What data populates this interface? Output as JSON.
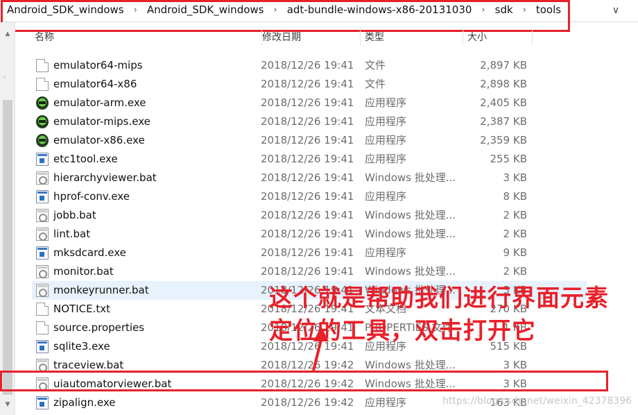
{
  "breadcrumbs": [
    "Android_SDK_windows",
    "Android_SDK_windows",
    "adt-bundle-windows-x86-20131030",
    "sdk",
    "tools"
  ],
  "addr_dropdown_glyph": "∨",
  "columns": {
    "name": "名称",
    "date": "修改日期",
    "type": "类型",
    "size": "大小"
  },
  "rows": [
    {
      "name": "emulator64-mips",
      "date": "2018/12/26 19:41",
      "type": "文件",
      "size": "2,897 KB",
      "icon": "file"
    },
    {
      "name": "emulator64-x86",
      "date": "2018/12/26 19:41",
      "type": "文件",
      "size": "2,898 KB",
      "icon": "file"
    },
    {
      "name": "emulator-arm.exe",
      "date": "2018/12/26 19:41",
      "type": "应用程序",
      "size": "2,405 KB",
      "icon": "emu"
    },
    {
      "name": "emulator-mips.exe",
      "date": "2018/12/26 19:41",
      "type": "应用程序",
      "size": "2,387 KB",
      "icon": "emu"
    },
    {
      "name": "emulator-x86.exe",
      "date": "2018/12/26 19:41",
      "type": "应用程序",
      "size": "2,359 KB",
      "icon": "emu"
    },
    {
      "name": "etc1tool.exe",
      "date": "2018/12/26 19:41",
      "type": "应用程序",
      "size": "255 KB",
      "icon": "exe"
    },
    {
      "name": "hierarchyviewer.bat",
      "date": "2018/12/26 19:41",
      "type": "Windows 批处理...",
      "size": "3 KB",
      "icon": "bat"
    },
    {
      "name": "hprof-conv.exe",
      "date": "2018/12/26 19:41",
      "type": "应用程序",
      "size": "8 KB",
      "icon": "exe"
    },
    {
      "name": "jobb.bat",
      "date": "2018/12/26 19:41",
      "type": "Windows 批处理...",
      "size": "2 KB",
      "icon": "bat"
    },
    {
      "name": "lint.bat",
      "date": "2018/12/26 19:41",
      "type": "Windows 批处理...",
      "size": "2 KB",
      "icon": "bat"
    },
    {
      "name": "mksdcard.exe",
      "date": "2018/12/26 19:41",
      "type": "应用程序",
      "size": "9 KB",
      "icon": "exe"
    },
    {
      "name": "monitor.bat",
      "date": "2018/12/26 19:41",
      "type": "Windows 批处理...",
      "size": "2 KB",
      "icon": "bat"
    },
    {
      "name": "monkeyrunner.bat",
      "date": "2018/12/26 19:41",
      "type": "Windows 批处理...",
      "size": "3 KB",
      "icon": "bat"
    },
    {
      "name": "NOTICE.txt",
      "date": "2018/12/26 19:41",
      "type": "文本文档",
      "size": "270 KB",
      "icon": "file"
    },
    {
      "name": "source.properties",
      "date": "2018/12/26 19:41",
      "type": "PROPERTIES 文件",
      "size": "1 KB",
      "icon": "file"
    },
    {
      "name": "sqlite3.exe",
      "date": "2018/12/26 19:41",
      "type": "应用程序",
      "size": "515 KB",
      "icon": "exe"
    },
    {
      "name": "traceview.bat",
      "date": "2018/12/26 19:42",
      "type": "Windows 批处理...",
      "size": "3 KB",
      "icon": "bat"
    },
    {
      "name": "uiautomatorviewer.bat",
      "date": "2018/12/26 19:42",
      "type": "Windows 批处理...",
      "size": "3 KB",
      "icon": "bat"
    },
    {
      "name": "zipalign.exe",
      "date": "2018/12/26 19:42",
      "type": "应用程序",
      "size": "163 KB",
      "icon": "exe"
    }
  ],
  "selected_row": "monkeyrunner.bat",
  "annotation": {
    "line1": "这个就是帮助我们进行界面元素",
    "line2": "定位的工具，双击打开它",
    "color": "#e8202a"
  },
  "watermark": "https://blog.csdn.net/weixin_42378396"
}
